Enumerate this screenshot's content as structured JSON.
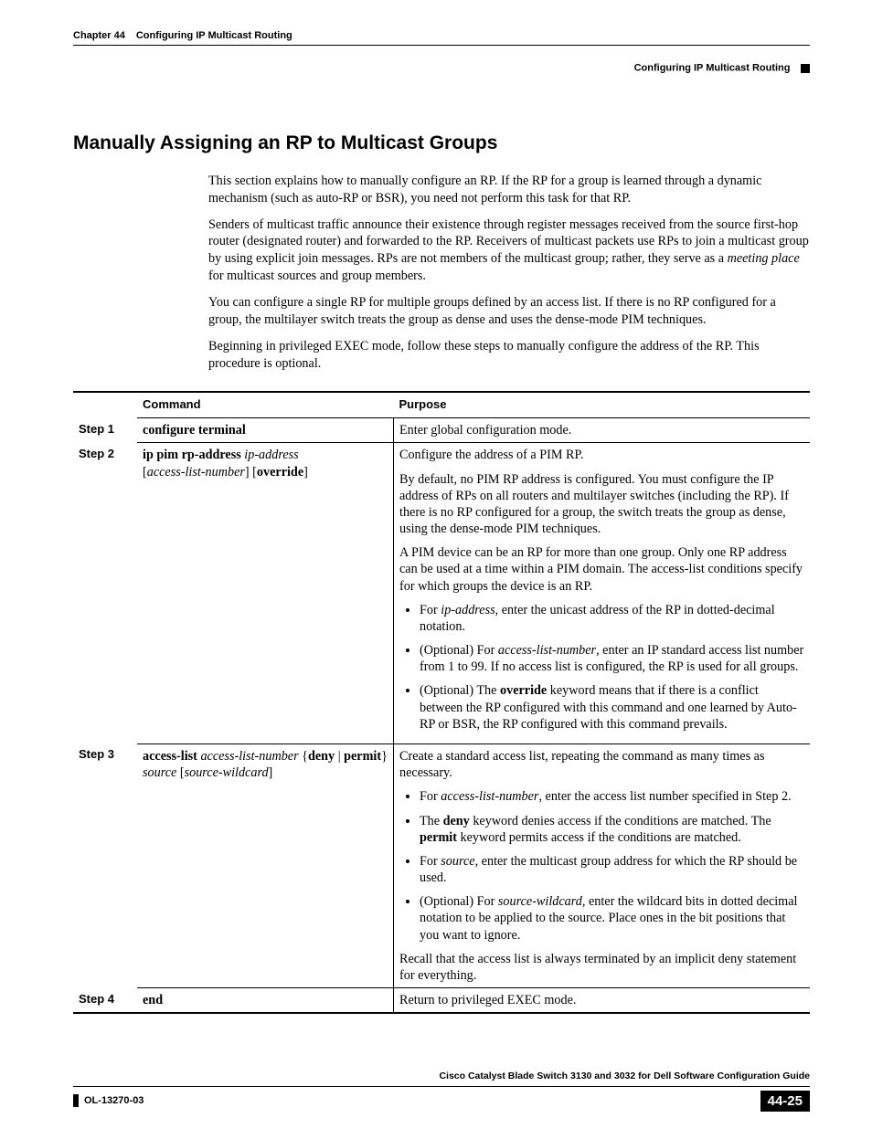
{
  "header": {
    "chapter": "Chapter 44",
    "title": "Configuring IP Multicast Routing",
    "subtitle": "Configuring IP Multicast Routing"
  },
  "section_title": "Manually Assigning an RP to Multicast Groups",
  "paragraphs": [
    "This section explains how to manually configure an RP. If the RP for a group is learned through a dynamic mechanism (such as auto-RP or BSR), you need not perform this task for that RP.",
    "Senders of multicast traffic announce their existence through register messages received from the source first-hop router (designated router) and forwarded to the RP. Receivers of multicast packets use RPs to join a multicast group by using explicit join messages. RPs are not members of the multicast group; rather, they serve as a ",
    " for multicast sources and group members.",
    "You can configure a single RP for multiple groups defined by an access list. If there is no RP configured for a group, the multilayer switch treats the group as dense and uses the dense-mode PIM techniques.",
    "Beginning in privileged EXEC mode, follow these steps to manually configure the address of the RP. This procedure is optional."
  ],
  "meeting_place": "meeting place",
  "table": {
    "head_cmd": "Command",
    "head_purpose": "Purpose",
    "rows": [
      {
        "step": "Step 1",
        "cmd_bold1": "configure terminal",
        "purpose_p1": "Enter global configuration mode."
      },
      {
        "step": "Step 2",
        "cmd_bold1": "ip pim rp-address ",
        "cmd_ital1": "ip-address",
        "cmd_line2_a": "[",
        "cmd_line2_ital": "access-list-number",
        "cmd_line2_b": "] [",
        "cmd_line2_bold": "override",
        "cmd_line2_c": "]",
        "purpose": {
          "p1": "Configure the address of a PIM RP.",
          "p2": "By default, no PIM RP address is configured. You must configure the IP address of RPs on all routers and multilayer switches (including the RP). If there is no RP configured for a group, the switch treats the group as dense, using the dense-mode PIM techniques.",
          "p3": "A PIM device can be an RP for more than one group. Only one RP address can be used at a time within a PIM domain. The access-list conditions specify for which groups the device is an RP.",
          "li1_a": "For ",
          "li1_i": "ip-address",
          "li1_b": ", enter the unicast address of the RP in dotted-decimal notation.",
          "li2_a": "(Optional) For ",
          "li2_i": "access-list-number",
          "li2_b": ", enter an IP standard access list number from 1 to 99. If no access list is configured, the RP is used for all groups.",
          "li3_a": "(Optional) The ",
          "li3_bold": "override",
          "li3_b": " keyword means that if there is a conflict between the RP configured with this command and one learned by Auto-RP or BSR, the RP configured with this command prevails."
        }
      },
      {
        "step": "Step 3",
        "cmd_bold1": "access-list ",
        "cmd_ital1": "access-list-number",
        "cmd_b2": " {",
        "cmd_bold2": "deny",
        "cmd_b3": " | ",
        "cmd_bold3": "permit",
        "cmd_b4": "} ",
        "cmd_ital2": "source",
        "cmd_b5": " [",
        "cmd_ital3": "source-wildcard",
        "cmd_b6": "]",
        "purpose": {
          "p1": "Create a standard access list, repeating the command as many times as necessary.",
          "li1_a": "For ",
          "li1_i": "access-list-number",
          "li1_b": ", enter the access list number specified in Step 2.",
          "li2_a": "The ",
          "li2_bold1": "deny",
          "li2_b": " keyword denies access if the conditions are matched. The ",
          "li2_bold2": "permit",
          "li2_c": " keyword permits access if the conditions are matched.",
          "li3_a": "For ",
          "li3_i": "source",
          "li3_b": ", enter the multicast group address for which the RP should be used.",
          "li4_a": "(Optional) For ",
          "li4_i": "source-wildcard",
          "li4_b": ", enter the wildcard bits in dotted decimal notation to be applied to the source. Place ones in the bit positions that you want to ignore.",
          "p2": "Recall that the access list is always terminated by an implicit deny statement for everything."
        }
      },
      {
        "step": "Step 4",
        "cmd_bold1": "end",
        "purpose_p1": "Return to privileged EXEC mode."
      }
    ]
  },
  "footer": {
    "doc_title": "Cisco Catalyst Blade Switch 3130 and 3032 for Dell Software Configuration Guide",
    "doc_id": "OL-13270-03",
    "page": "44-25"
  }
}
